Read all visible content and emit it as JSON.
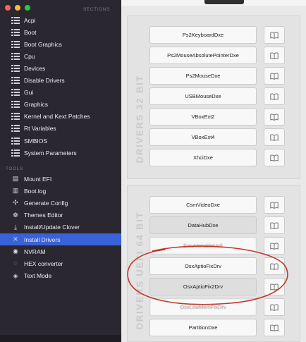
{
  "sidebar": {
    "section_header": "SECTIONS",
    "tools_header": "TOOLS",
    "sections": [
      {
        "label": "Acpi",
        "icon": "list-icon"
      },
      {
        "label": "Boot",
        "icon": "list-icon"
      },
      {
        "label": "Boot Graphics",
        "icon": "list-icon"
      },
      {
        "label": "Cpu",
        "icon": "list-icon"
      },
      {
        "label": "Devices",
        "icon": "list-icon"
      },
      {
        "label": "Disable Drivers",
        "icon": "list-icon"
      },
      {
        "label": "Gui",
        "icon": "list-icon"
      },
      {
        "label": "Graphics",
        "icon": "list-icon"
      },
      {
        "label": "Kernel and Kext Patches",
        "icon": "list-icon"
      },
      {
        "label": "Rt Variables",
        "icon": "list-icon"
      },
      {
        "label": "SMBIOS",
        "icon": "list-icon"
      },
      {
        "label": "System Parameters",
        "icon": "list-icon"
      }
    ],
    "tools": [
      {
        "label": "Mount EFI",
        "icon": "disk-icon",
        "glyph": "▤"
      },
      {
        "label": "Boot.log",
        "icon": "log-icon",
        "glyph": "▥"
      },
      {
        "label": "Generate Config",
        "icon": "magic-icon",
        "glyph": "✣"
      },
      {
        "label": "Themes Editor",
        "icon": "palette-icon",
        "glyph": "❁"
      },
      {
        "label": "Install/Update Clover",
        "icon": "download-icon",
        "glyph": "⤓"
      },
      {
        "label": "Install Drivers",
        "icon": "tools-icon",
        "glyph": "✕",
        "selected": true
      },
      {
        "label": "NVRAM",
        "icon": "chip-icon",
        "glyph": "◉"
      },
      {
        "label": "HEX converter",
        "icon": "convert-icon",
        "glyph": "◌"
      },
      {
        "label": "Text Mode",
        "icon": "eye-icon",
        "glyph": "◈"
      }
    ]
  },
  "panels": {
    "drivers32_label": "DRIVERS 32 BIT",
    "drivers64_label": "DRIVERS UEFI 64 BIT"
  },
  "drivers32": [
    {
      "name": "Ps2KeyboardDxe",
      "selected": false
    },
    {
      "name": "Ps2MouseAbsolutePointerDxe",
      "selected": false
    },
    {
      "name": "Ps2MouseDxe",
      "selected": false
    },
    {
      "name": "USBMouseDxe",
      "selected": false
    },
    {
      "name": "VBoxExt2",
      "selected": false
    },
    {
      "name": "VBoxExt4",
      "selected": false
    },
    {
      "name": "XhciDxe",
      "selected": false
    }
  ],
  "drivers64": [
    {
      "name": "CsmVideoDxe",
      "selected": false
    },
    {
      "name": "DataHubDxe",
      "selected": true
    },
    {
      "name": "EmuVariableUefi",
      "selected": false,
      "blurred": true
    },
    {
      "name": "OsxAptioFixDrv",
      "selected": false
    },
    {
      "name": "OsxAptioFix2Drv",
      "selected": true
    },
    {
      "name": "OsxLowMemFixDrv",
      "selected": false,
      "blurred": true
    },
    {
      "name": "PartitionDxe",
      "selected": false
    }
  ],
  "icons": {
    "info_button": "book-icon",
    "annotation": "red-ellipse-annotation"
  },
  "colors": {
    "sidebar_bg": "#2b2730",
    "selection": "#3a62d8",
    "annotation": "#c0392b",
    "traffic_red": "#fe5f57",
    "traffic_yellow": "#febc2e",
    "traffic_green": "#28c840"
  }
}
